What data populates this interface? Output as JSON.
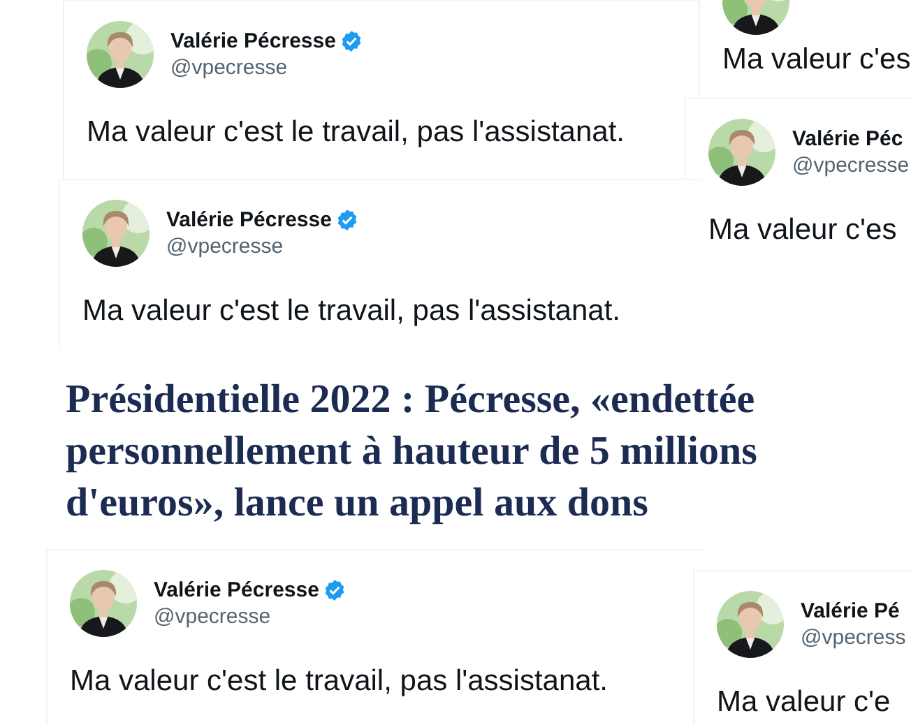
{
  "tweets": [
    {
      "name": "Valérie Pécresse",
      "handle": "@vpecresse",
      "verified": true,
      "text": "Ma valeur c'est le travail, pas l'assistanat."
    },
    {
      "text": "Ma valeur c'es"
    },
    {
      "name": "Valérie Péc",
      "handle": "@vpecresse",
      "text": "Ma valeur c'es"
    },
    {
      "name": "Valérie Pécresse",
      "handle": "@vpecresse",
      "verified": true,
      "text": "Ma valeur c'est le travail, pas l'assistanat."
    },
    {
      "name": "Valérie Pécresse",
      "handle": "@vpecresse",
      "verified": true,
      "text": "Ma valeur c'est le travail, pas l'assistanat."
    },
    {
      "name": "Valérie Pé",
      "handle": "@vpecress",
      "text": "Ma valeur c'e"
    }
  ],
  "headline": {
    "lines": [
      "Présidentielle 2022 : Pécresse, «endettée",
      "personnellement à hauteur de 5 millions",
      "d'euros», lance un appel aux dons"
    ]
  }
}
